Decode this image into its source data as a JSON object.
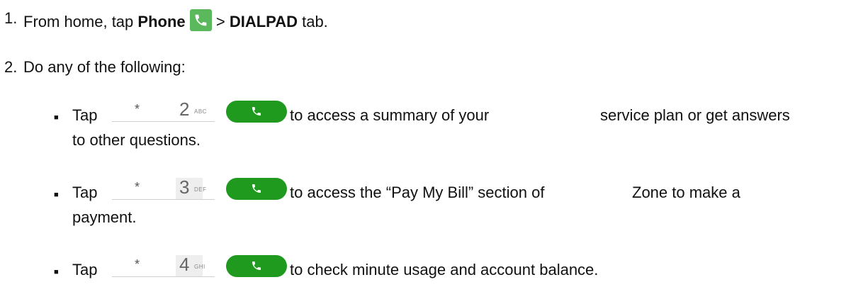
{
  "step1": {
    "number": "1.",
    "prefix": "From home, tap ",
    "phone_label": "Phone",
    "separator": " > ",
    "dialpad_label": "DIALPAD",
    "suffix": " tab."
  },
  "step2": {
    "number": "2.",
    "text": "Do any of the following:"
  },
  "items": [
    {
      "tap": "Tap",
      "key_symbol": "*",
      "key_digit": "2",
      "key_letters": "ABC",
      "line1_a": "to access a summary of your",
      "line1_b": "service plan or get answers",
      "line2": "to other questions."
    },
    {
      "tap": "Tap",
      "key_symbol": "*",
      "key_digit": "3",
      "key_letters": "DEF",
      "line1_a": "to access the “Pay My Bill” section of",
      "line1_b": "Zone to make a",
      "line2": "payment."
    },
    {
      "tap": "Tap",
      "key_symbol": "*",
      "key_digit": "4",
      "key_letters": "GHI",
      "line1_a": "to check minute usage and account balance."
    }
  ],
  "icons": {
    "phone_app": "phone-icon",
    "call_button": "phone-icon",
    "accent_green": "#5cb85c",
    "call_green": "#1f9a1f"
  }
}
